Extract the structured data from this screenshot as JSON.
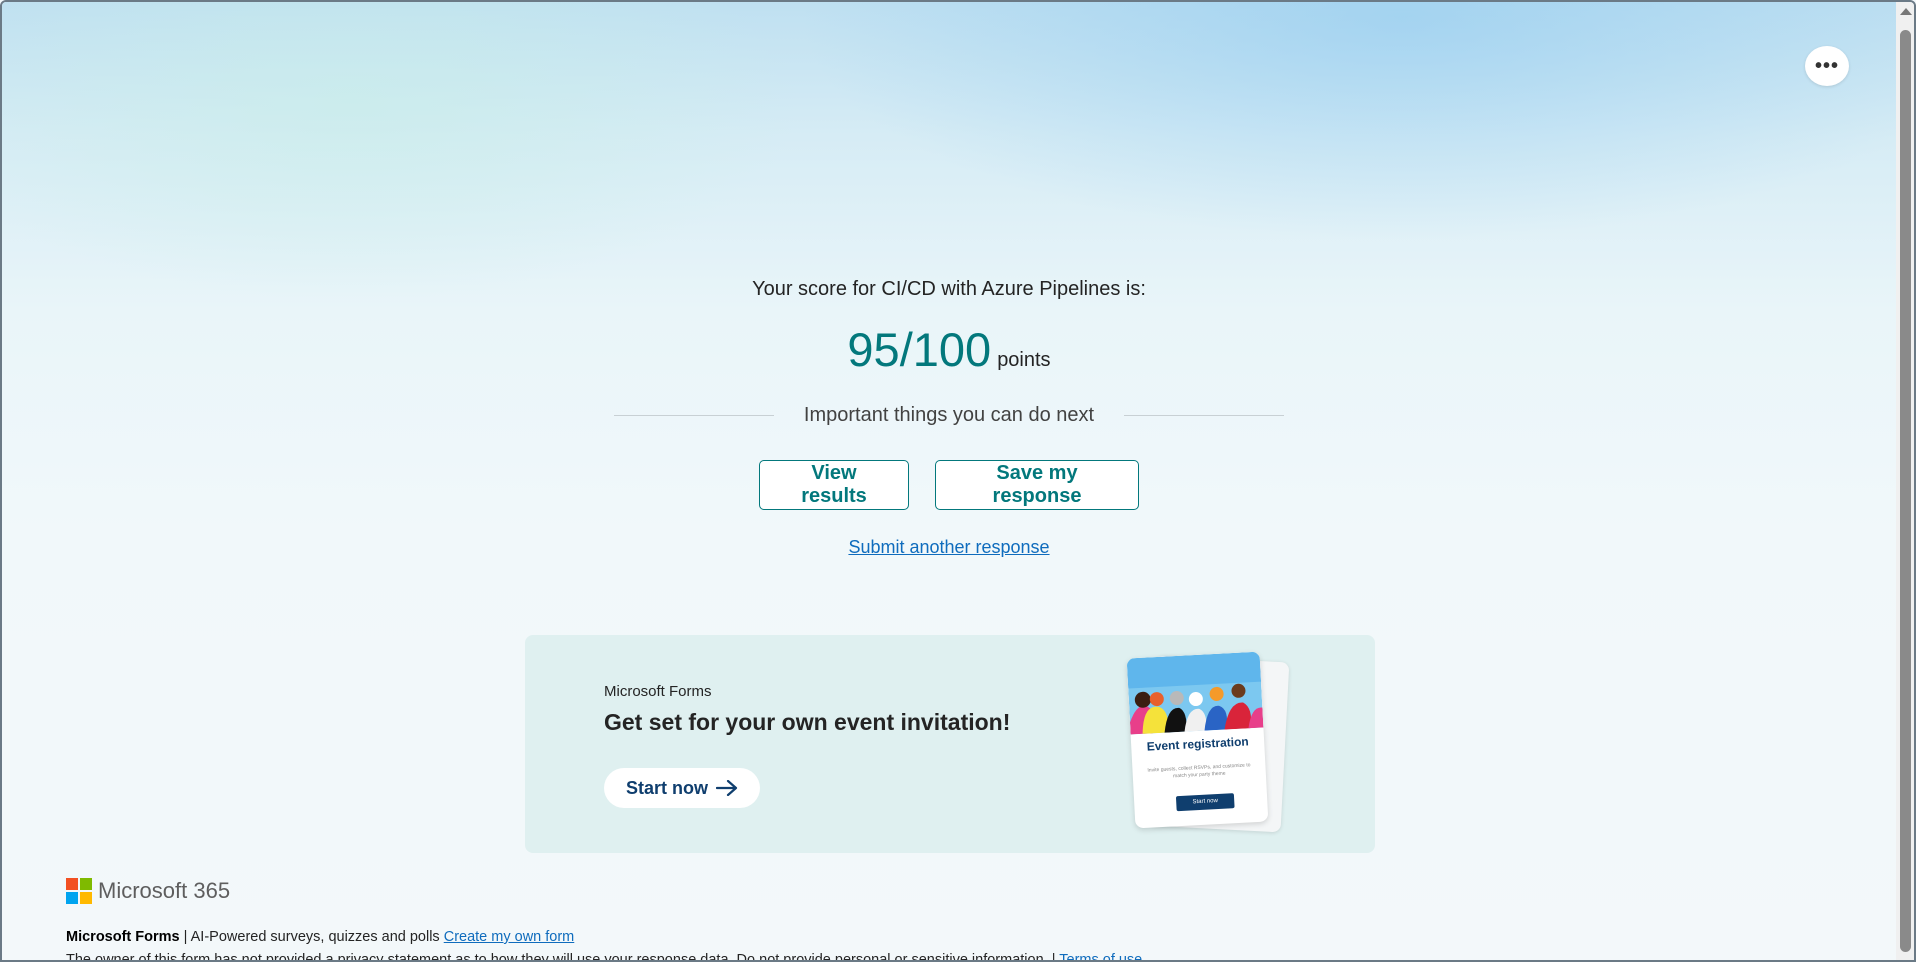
{
  "menu": {
    "more_icon": "more-horizontal-icon",
    "more_label": "•••"
  },
  "score": {
    "label": "Your score for CI/CD with Azure Pipelines is:",
    "value": "95/100",
    "unit": "points"
  },
  "next": {
    "heading": "Important things you can do next",
    "view_results": "View results",
    "save_response": "Save my response",
    "submit_another": "Submit another response"
  },
  "promo": {
    "brand": "Microsoft Forms",
    "title": "Get set for your own event invitation!",
    "start_label": "Start now",
    "card_title": "Event registration",
    "card_text": "Invite guests, collect RSVPs, and customize to match your party theme",
    "card_button": "Start now"
  },
  "footer": {
    "logo_text": "Microsoft 365",
    "product": "Microsoft Forms",
    "separator": "|",
    "tagline": "AI-Powered surveys, quizzes and polls",
    "create_link": "Create my own form",
    "privacy_text": "The owner of this form has not provided a privacy statement as to how they will use your response data. Do not provide personal or sensitive information. |",
    "terms_link": "Terms of use"
  },
  "colors": {
    "accent": "#03787c",
    "link": "#0f6cbd",
    "promo_bg": "#dff0f0",
    "ms_red": "#f25022",
    "ms_green": "#7fba00",
    "ms_blue": "#00a4ef",
    "ms_yellow": "#ffb900"
  }
}
